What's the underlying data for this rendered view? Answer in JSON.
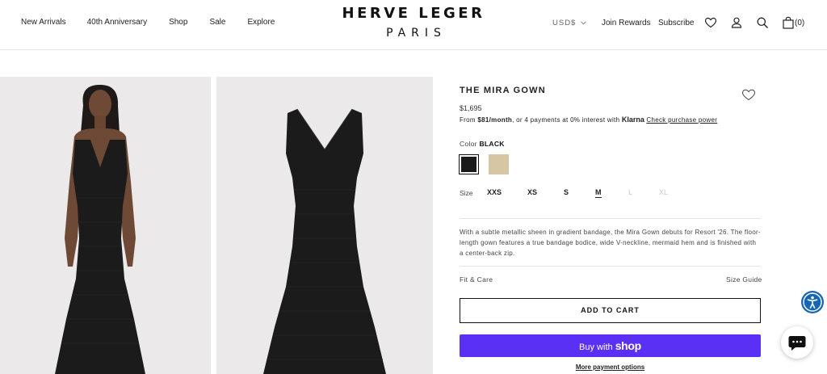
{
  "header": {
    "nav_left": [
      "New Arrivals",
      "40th Anniversary",
      "Shop",
      "Sale",
      "Explore"
    ],
    "logo_top": "HERVE LEGER",
    "logo_bottom": "PARIS",
    "currency": "USD$",
    "join_rewards": "Join Rewards",
    "subscribe": "Subscribe",
    "cart_count": "(0)",
    "icons": [
      "heart-icon",
      "account-icon",
      "search-icon",
      "bag-icon",
      "chevron-down-icon"
    ]
  },
  "product": {
    "title": "THE MIRA GOWN",
    "price": "$1,695",
    "klarna_prefix": "From ",
    "klarna_amount": "$81/month",
    "klarna_middle": ", or 4 payments at 0% interest with ",
    "klarna_brand": "Klarna",
    "klarna_link": "Check purchase power",
    "color_label": "Color",
    "color_value": "BLACK",
    "swatches": [
      {
        "name": "Black",
        "color": "#1a1a1a",
        "selected": true
      },
      {
        "name": "Gold",
        "color": "#d6c6a3",
        "selected": false
      }
    ],
    "size_label": "Size",
    "sizes": [
      {
        "label": "XXS",
        "available": true,
        "selected": false
      },
      {
        "label": "XS",
        "available": true,
        "selected": false
      },
      {
        "label": "S",
        "available": true,
        "selected": false
      },
      {
        "label": "M",
        "available": true,
        "selected": true
      },
      {
        "label": "L",
        "available": false,
        "selected": false
      },
      {
        "label": "XL",
        "available": false,
        "selected": false
      }
    ],
    "description": "With a subtle metallic sheen in gradient bandage, the Mira Gown debuts for Resort '26. The floor-length gown features a true bandage bodice, wide V-neckline, mermaid hem and is finished with a center-back zip.",
    "fit_care": "Fit & Care",
    "size_guide": "Size Guide",
    "add_to_cart": "ADD TO CART",
    "buy_with": "Buy with",
    "shop_word": "shop",
    "more_payment": "More payment options"
  },
  "colors": {
    "shop_pay": "#5a31f4",
    "accessibility": "#1566b3",
    "image_bg": "#ebe9ea"
  }
}
